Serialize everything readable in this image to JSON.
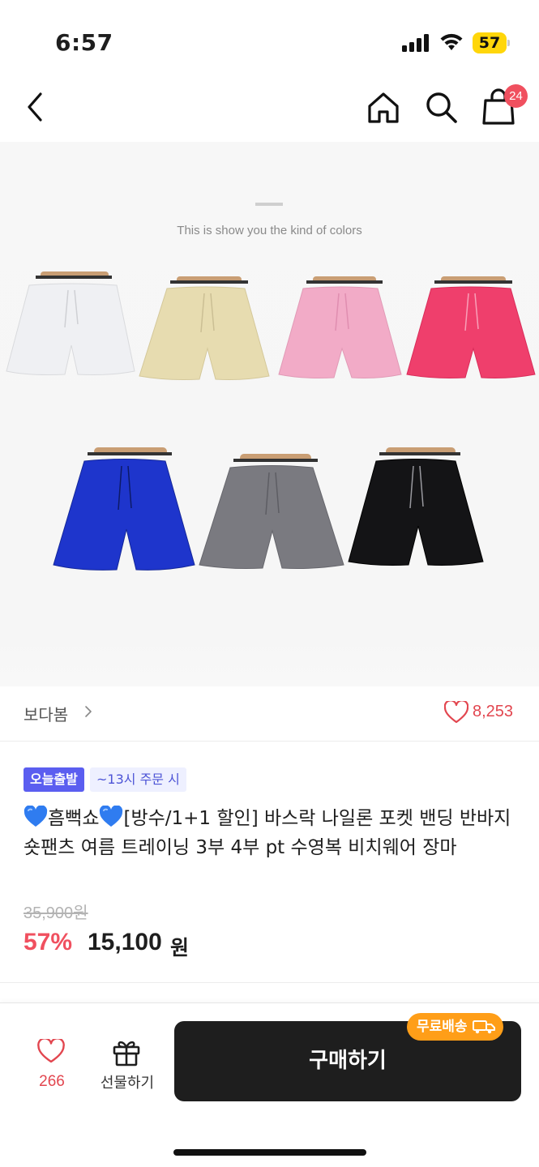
{
  "status_bar": {
    "time": "6:57",
    "battery": "57"
  },
  "nav": {
    "cart_count": "24"
  },
  "product_image": {
    "caption": "This is show you the kind of colors",
    "colors": [
      "#eff0f3",
      "#e7dcb0",
      "#f2abc7",
      "#ef3f6c",
      "#1e35cc",
      "#7a7a80",
      "#141416"
    ]
  },
  "shop": {
    "name": "보다봄",
    "chevron": ">",
    "like_count": "8,253"
  },
  "product": {
    "badge_today": "오늘출발",
    "badge_time": "~13시 주문 시",
    "title_part1": "흠뻑쇼",
    "title_part2": "[방수/1+1 할인] 바스락 나일론 포켓 밴딩 반바지 숏팬츠 여름 트레이닝 3부 4부 pt 수영복 비치웨어 장마",
    "original_price": "35,900원",
    "discount": "57%",
    "sale_price": "15,100",
    "currency": "원"
  },
  "bottom_bar": {
    "wish_count": "266",
    "gift_label": "선물하기",
    "buy_label": "구매하기",
    "free_shipping": "무료배송"
  }
}
